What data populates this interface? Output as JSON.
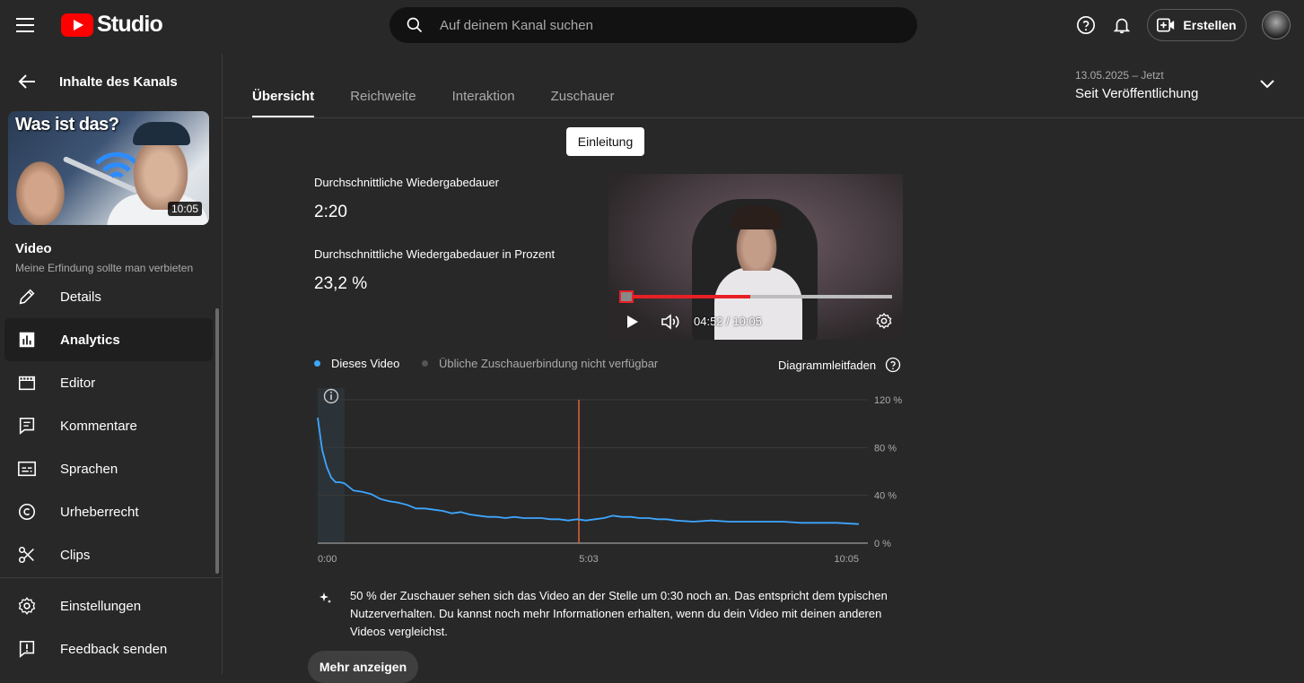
{
  "header": {
    "logo_text": "Studio",
    "search_placeholder": "Auf deinem Kanal suchen",
    "create_label": "Erstellen"
  },
  "sidebar": {
    "back_label": "Inhalte des Kanals",
    "thumbnail_title": "Was ist das?",
    "thumbnail_duration": "10:05",
    "video_label": "Video",
    "video_subtitle": "Meine Erfindung sollte man verbieten",
    "items": [
      {
        "label": "Details",
        "icon": "pencil-icon",
        "active": false
      },
      {
        "label": "Analytics",
        "icon": "analytics-icon",
        "active": true
      },
      {
        "label": "Editor",
        "icon": "clapper-icon",
        "active": false
      },
      {
        "label": "Kommentare",
        "icon": "comment-icon",
        "active": false
      },
      {
        "label": "Sprachen",
        "icon": "subtitles-icon",
        "active": false
      },
      {
        "label": "Urheberrecht",
        "icon": "copyright-icon",
        "active": false
      },
      {
        "label": "Clips",
        "icon": "scissors-icon",
        "active": false
      }
    ],
    "bottom_items": [
      {
        "label": "Einstellungen",
        "icon": "gear-icon"
      },
      {
        "label": "Feedback senden",
        "icon": "feedback-icon"
      }
    ]
  },
  "tabs": [
    {
      "label": "Übersicht",
      "active": true
    },
    {
      "label": "Reichweite",
      "active": false
    },
    {
      "label": "Interaktion",
      "active": false
    },
    {
      "label": "Zuschauer",
      "active": false
    }
  ],
  "date_range": {
    "dates": "13.05.2025 – Jetzt",
    "label": "Seit Veröffentlichung"
  },
  "tooltip_label": "Einleitung",
  "metrics": [
    {
      "label": "Durchschnittliche Wiedergabedauer",
      "value": "2:20"
    },
    {
      "label": "Durchschnittliche Wiedergabedauer in Prozent",
      "value": "23,2 %"
    }
  ],
  "player": {
    "time_display": "04:52 / 10:05",
    "progress": 0.48
  },
  "legend": {
    "this_video": "Dieses Video",
    "typical": "Übliche Zuschauerbindung nicht verfügbar",
    "guide": "Diagrammleitfaden"
  },
  "colors": {
    "series": "#3ea6ff",
    "marker": "#e0643a",
    "intro_band": "#2b3338"
  },
  "chart_data": {
    "type": "line",
    "xlabel": "",
    "ylabel": "",
    "x_ticks": [
      "0:00",
      "5:03",
      "10:05"
    ],
    "y_ticks": [
      "120 %",
      "80 %",
      "40 %",
      "0 %"
    ],
    "x_range_seconds": [
      0,
      605
    ],
    "ylim": [
      0,
      120
    ],
    "intro_band_seconds": [
      0,
      30
    ],
    "marker_seconds": 292,
    "series": [
      {
        "name": "Dieses Video",
        "x": [
          0,
          5,
          10,
          15,
          20,
          25,
          30,
          40,
          50,
          60,
          70,
          80,
          90,
          100,
          110,
          120,
          130,
          140,
          150,
          160,
          170,
          180,
          190,
          200,
          210,
          220,
          230,
          240,
          250,
          260,
          270,
          280,
          290,
          300,
          310,
          320,
          330,
          340,
          350,
          360,
          370,
          380,
          390,
          400,
          420,
          440,
          460,
          480,
          500,
          520,
          540,
          560,
          580,
          605
        ],
        "y": [
          105,
          78,
          64,
          55,
          51,
          51,
          50,
          44,
          43,
          41,
          37,
          35,
          34,
          32,
          29,
          29,
          28,
          27,
          25,
          26,
          24,
          23,
          22,
          22,
          21,
          22,
          21,
          21,
          21,
          20,
          20,
          19,
          20,
          19,
          20,
          21,
          23,
          22,
          22,
          21,
          21,
          20,
          20,
          19,
          18,
          19,
          18,
          18,
          18,
          18,
          17,
          17,
          17,
          16
        ]
      }
    ]
  },
  "insight_text": "50 % der Zuschauer sehen sich das Video an der Stelle um 0:30 noch an. Das entspricht dem typischen Nutzerverhalten. Du kannst noch mehr Informationen erhalten, wenn du dein Video mit deinen anderen Videos vergleichst.",
  "more_button": "Mehr anzeigen"
}
